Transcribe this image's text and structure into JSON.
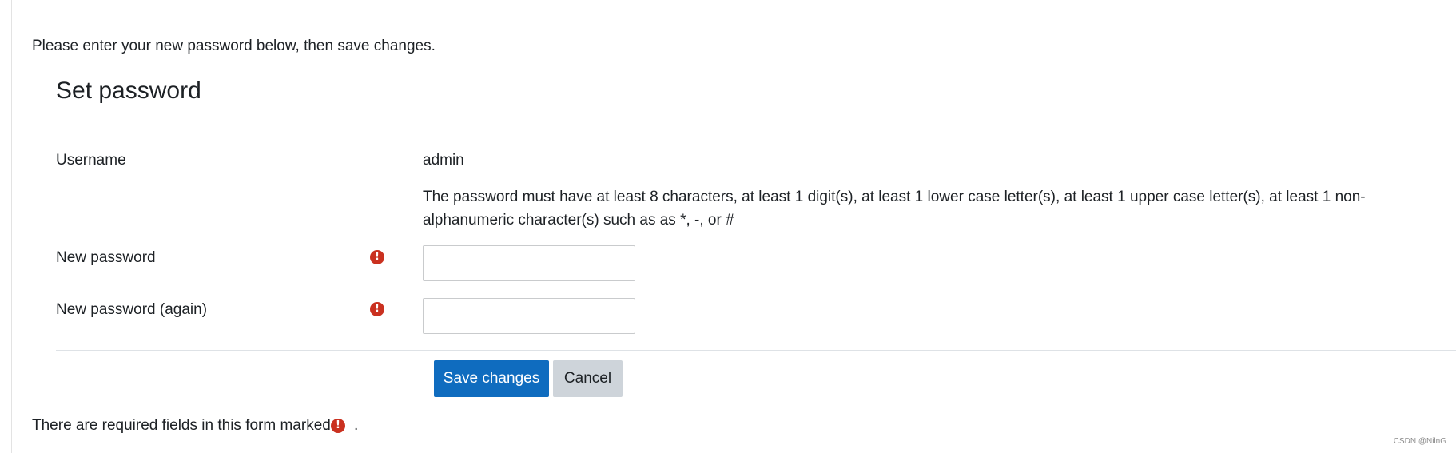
{
  "intro_text": "Please enter your new password below, then save changes.",
  "form": {
    "title": "Set password",
    "username_label": "Username",
    "username_value": "admin",
    "password_rules": "The password must have at least 8 characters, at least 1 digit(s), at least 1 lower case letter(s), at least 1 upper case letter(s), at least 1 non-alphanumeric character(s) such as as *, -, or #",
    "new_password_label": "New password",
    "new_password_value": "",
    "new_password_again_label": "New password (again)",
    "new_password_again_value": "",
    "required_icon": "exclamation-circle-icon",
    "required_glyph": "!"
  },
  "buttons": {
    "save_label": "Save changes",
    "cancel_label": "Cancel"
  },
  "footer": {
    "required_note": "There are required fields in this form marked",
    "required_note_end": "."
  },
  "watermark": "CSDN @NilnG",
  "colors": {
    "primary": "#0f6cbf",
    "secondary": "#ced4da",
    "required": "#ca3120",
    "text": "#1d2125"
  }
}
